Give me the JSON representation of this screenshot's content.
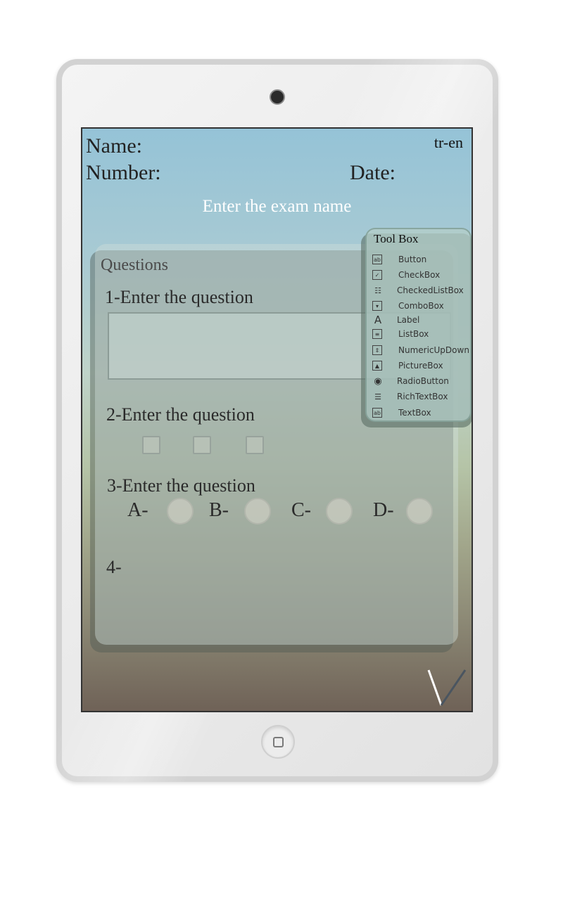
{
  "header": {
    "name_label": "Name:",
    "number_label": "Number:",
    "date_label": "Date:",
    "language": "tr-en"
  },
  "exam": {
    "name_placeholder": "Enter the exam name"
  },
  "questions": {
    "title": "Questions",
    "q1": "1-Enter the question",
    "q2": "2-Enter the question",
    "q3": "3-Enter the question",
    "q4": "4-",
    "options": [
      "A-",
      "B-",
      "C-",
      "D-"
    ]
  },
  "toolbox": {
    "title": "Tool Box",
    "items": [
      {
        "label": "Button",
        "icon": "button-icon"
      },
      {
        "label": "CheckBox",
        "icon": "checkbox-icon"
      },
      {
        "label": "CheckedListBox",
        "icon": "checked-list-icon"
      },
      {
        "label": "ComboBox",
        "icon": "combobox-icon"
      },
      {
        "label": "Label",
        "icon": "label-icon"
      },
      {
        "label": "ListBox",
        "icon": "listbox-icon"
      },
      {
        "label": "NumericUpDown",
        "icon": "numeric-updown-icon"
      },
      {
        "label": "PictureBox",
        "icon": "picturebox-icon"
      },
      {
        "label": "RadioButton",
        "icon": "radiobutton-icon"
      },
      {
        "label": "RichTextBox",
        "icon": "richtextbox-icon"
      },
      {
        "label": "TextBox",
        "icon": "textbox-icon"
      }
    ]
  },
  "colors": {
    "screen_top": "#95c3d7",
    "screen_bottom": "#6f6257",
    "exam_name_text": "#ffffff"
  }
}
